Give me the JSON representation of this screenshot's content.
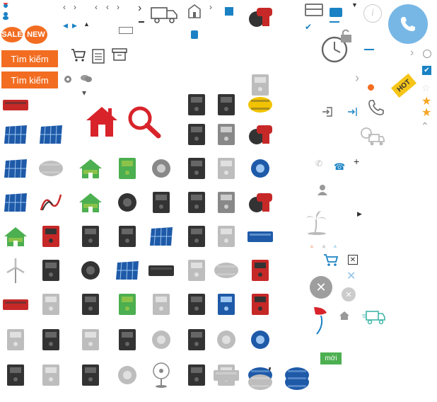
{
  "badges": {
    "sale": "SALE",
    "new": "NEW",
    "hot": "HOT",
    "new_tag": "mới"
  },
  "search_buttons": [
    "Tìm kiếm",
    "Tìm kiếm"
  ],
  "info_label": "i",
  "colors": {
    "accent": "#f26d21",
    "phone": "#77b7e6",
    "product_red": "#d8232a",
    "link_blue": "#1a82c4"
  },
  "product_icons": [
    "inverter",
    "solar-panel-mono",
    "solar-panel-blue",
    "solar-panel-poly",
    "solar-house",
    "wind-turbine",
    "inverter-red",
    "power-inverter",
    "ups-inverter",
    "battery-box",
    "solar-panel-small",
    "solar-water-heater",
    "battery-cables",
    "battery-charger",
    "battery-pack",
    "heat-sink-panel",
    "mppt-controller",
    "charge-controller",
    "home-icon",
    "solar-system-diagram",
    "green-house",
    "solar-kit",
    "remote-key",
    "car-tracker",
    "solar-cells",
    "remote-control",
    "card-reader",
    "flashlight",
    "control-box",
    "magnifier-icon",
    "industrial-motor",
    "tracker-device",
    "solar-cell-black",
    "card-device",
    "thermal-camera",
    "floodlight",
    "led-bulb",
    "energy-bulb",
    "desk-fan",
    "smart-bulb",
    "frequency-inverter",
    "vfd-panel",
    "vfd-drive",
    "vfd-drive-2",
    "vfd-drive-3",
    "vfd-drive-4",
    "vfd-drive-5",
    "vfd-drive-6",
    "vfd-drive-7",
    "vfd-drive-8",
    "network-switch",
    "electric-box",
    "uv-box",
    "ice-machine",
    "ultrasonic-cleaner",
    "water-heater",
    "display-fridge",
    "washing-machine",
    "fridge",
    "air-conditioner",
    "circular-saw",
    "yellow-compressor",
    "chest-freezer",
    "cutoff-saw",
    "sander",
    "angle-grinder",
    "power-drill",
    "generator",
    "welder",
    "water-pump",
    "cable-set",
    "pressure-tank",
    "water-tank-blue",
    "water-tank-blue-2",
    "water-tank-steel"
  ],
  "sidebar_icons": [
    "credit-card-icon",
    "check-icon",
    "timer-lock-icon",
    "login-icon",
    "logout-icon",
    "phone-outline-icon",
    "truck-icon",
    "phone-small-icon",
    "phone-blue-icon",
    "user-icon",
    "palm-tree-icon",
    "cart-icon",
    "close-box-icon",
    "close-blue-icon",
    "close-circle-icon",
    "close-circle-small-icon",
    "red-flag-icon",
    "house-small-icon",
    "delivery-truck-icon",
    "star-outline-icon",
    "star-full-icon",
    "star-full-icon-2",
    "chevron-up-icon"
  ]
}
